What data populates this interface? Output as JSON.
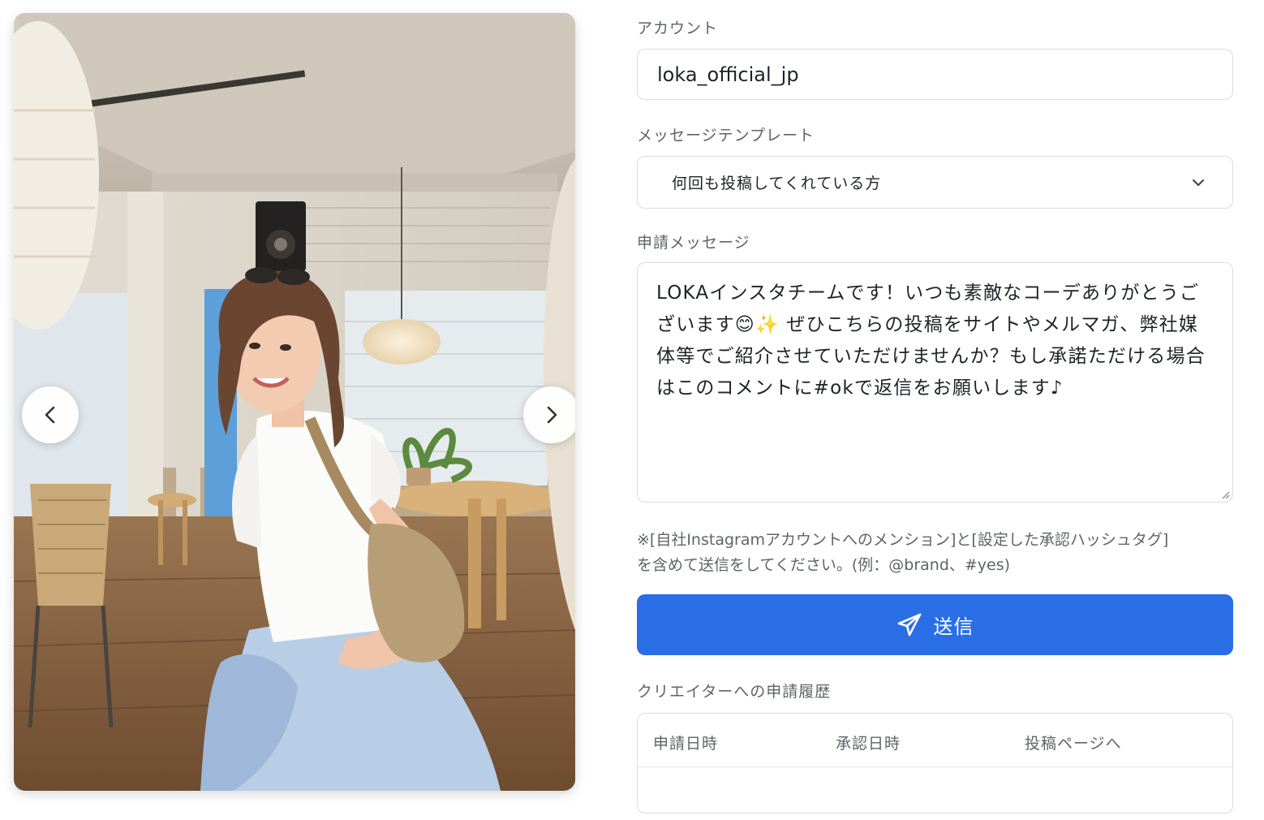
{
  "photo": {
    "prev_icon": "chevron-left-icon",
    "next_icon": "chevron-right-icon"
  },
  "account": {
    "label": "アカウント",
    "value": "loka_official_jp"
  },
  "template": {
    "label": "メッセージテンプレート",
    "selected": "何回も投稿してくれている方",
    "icon": "chevron-down-icon"
  },
  "message": {
    "label": "申請メッセージ",
    "text": "LOKAインスタチームです！いつも素敵なコーデありがとうございます😊✨ ぜひこちらの投稿をサイトやメルマガ、弊社媒体等でご紹介させていただけませんか？もし承諾ただける場合はこのコメントに#okで返信をお願いします♪"
  },
  "note": {
    "line1": "※[自社Instagramアカウントへのメンション]と[設定した承認ハッシュタグ]",
    "line2": "を含めて送信をしてください。(例：@brand、#yes)"
  },
  "send": {
    "label": "送信",
    "icon": "send-icon",
    "color": "#2a6ee6"
  },
  "history": {
    "label": "クリエイターへの申請履歴",
    "columns": [
      "申請日時",
      "承認日時",
      "投稿ページへ"
    ],
    "rows": []
  }
}
